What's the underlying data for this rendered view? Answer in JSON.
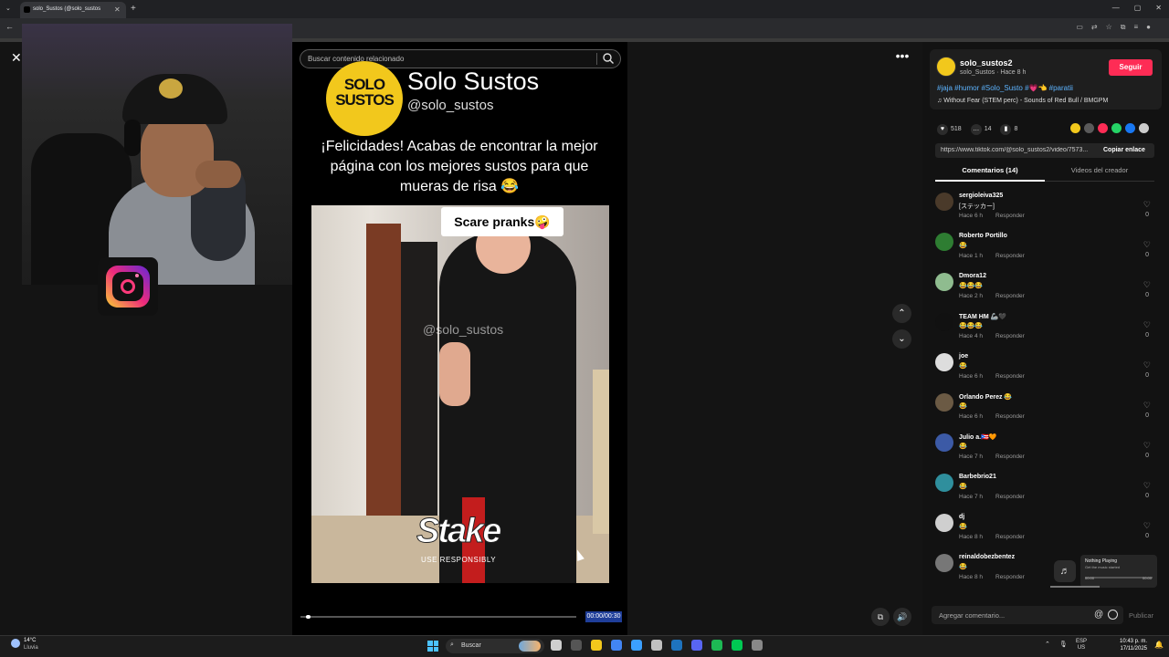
{
  "browser": {
    "tab_title": "solo_Sustos (@solo_sustos",
    "tab_close": "✕",
    "new_tab": "+",
    "window_controls": [
      "—",
      "▢",
      "✕"
    ]
  },
  "overlay": {
    "close": "✕",
    "search_placeholder": "Buscar contenido relacionado"
  },
  "video": {
    "brand_logo_text": "SOLO SUSTOS",
    "brand_name": "Solo Sustos",
    "brand_handle": "@solo_sustos",
    "caption": "¡Felicidades! Acabas de encontrar la mejor página con los mejores sustos para que mueras de risa 😂",
    "clip_label": "Scare pranks🤪",
    "watermark": "@solo_sustos",
    "sponsor": "Stake",
    "sponsor_sub": "USE RESPONSIBLY",
    "time": "00:00/00:30",
    "progress": 0.02
  },
  "controls": {
    "more": "•••",
    "up": "⌃",
    "down": "⌄",
    "pip": "⧉",
    "volume": "🔊"
  },
  "post": {
    "author": "solo_sustos2",
    "author_sub": "solo_Sustos · Hace 8 h",
    "follow_label": "Seguir",
    "tags": "#jaja #humor #Solo_Susto #💗👈 #paratii",
    "music": "♫  Without Fear (STEM perc) - Sounds of Red Bull / BMGPM",
    "likes": "518",
    "comments": "14",
    "saves": "8",
    "link": "https://www.tiktok.com/@solo_sustos2/video/7573...",
    "copy_link": "Copiar enlace",
    "tab_comments": "Comentarios (14)",
    "tab_creator": "Videos del creador",
    "share_colors": [
      "#f2c81c",
      "#5a5a5a",
      "#fe2c55",
      "#25d366",
      "#1877f2",
      "#cccccc"
    ]
  },
  "comments": [
    {
      "name": "sergioleiva325",
      "text": "[ステッカー]",
      "time": "Hace 6 h",
      "reply": "Responder",
      "likes": "0",
      "avatar_color": "#4a3a2a"
    },
    {
      "name": "Roberto Portillo",
      "text": "😂",
      "time": "Hace 1 h",
      "reply": "Responder",
      "likes": "0",
      "avatar_color": "#2e7d32"
    },
    {
      "name": "Dmora12",
      "text": "😂😂😂",
      "time": "Hace 2 h",
      "reply": "Responder",
      "likes": "0",
      "avatar_color": "#8fbc8f"
    },
    {
      "name": "TEAM HM 🦾🖤",
      "text": "😂😂😂",
      "time": "Hace 4 h",
      "reply": "Responder",
      "likes": "0",
      "avatar_color": "#111111"
    },
    {
      "name": "joe",
      "text": "😂",
      "time": "Hace 6 h",
      "reply": "Responder",
      "likes": "0",
      "avatar_color": "#dddddd"
    },
    {
      "name": "Orlando Perez 😂",
      "text": "😂",
      "time": "Hace 6 h",
      "reply": "Responder",
      "likes": "0",
      "avatar_color": "#6b5a44"
    },
    {
      "name": "Julio a.🇵🇷🧡",
      "text": "😂",
      "time": "Hace 7 h",
      "reply": "Responder",
      "likes": "0",
      "avatar_color": "#3c5aa6"
    },
    {
      "name": "Barbebrio21",
      "text": "😂",
      "time": "Hace 7 h",
      "reply": "Responder",
      "likes": "0",
      "avatar_color": "#2f8f9d"
    },
    {
      "name": "dj",
      "text": "😂",
      "time": "Hace 8 h",
      "reply": "Responder",
      "likes": "0",
      "avatar_color": "#cfcfcf"
    },
    {
      "name": "reinaldobezbentez",
      "text": "😂",
      "time": "Hace 8 h",
      "reply": "Responder",
      "likes": "0",
      "avatar_color": "#777777"
    }
  ],
  "comment_input": {
    "placeholder": "Agregar comentario...",
    "at": "@",
    "publish": "Publicar"
  },
  "media": {
    "title": "Nothing Playing",
    "subtitle": "Get the music started",
    "t0": "00:00",
    "t1": "00:00"
  },
  "taskbar": {
    "temp": "14°C",
    "condition": "Lluvia",
    "search": "Buscar",
    "lang_1": "ESP",
    "lang_2": "US",
    "time": "10:43 p. m.",
    "date": "17/11/2025",
    "app_colors": [
      "#cfcfcf",
      "#555555",
      "#f2c81c",
      "#4285f4",
      "#3ba0ff",
      "#c0c0c0",
      "#1e73be",
      "#5865f2",
      "#1db954",
      "#00c853",
      "#888888"
    ]
  }
}
